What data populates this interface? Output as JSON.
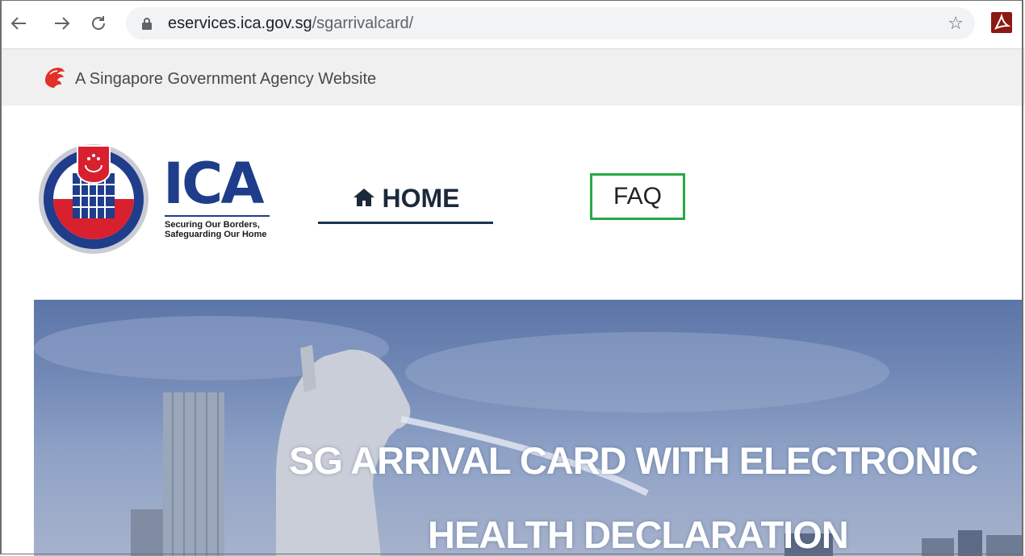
{
  "browser": {
    "url_host": "eservices.ica.gov.sg",
    "url_path": "/sgarrivalcard/",
    "icons": [
      "back-arrow-icon",
      "forward-arrow-icon",
      "reload-icon",
      "lock-icon",
      "bookmark-star-icon",
      "pdf-extension-icon"
    ]
  },
  "masthead": {
    "text": "A Singapore Government Agency Website",
    "icon": "lion-head-icon"
  },
  "logo": {
    "title": "ICA",
    "tagline_line1": "Securing Our Borders,",
    "tagline_line2": "Safeguarding Our Home",
    "brand_color": "#1f3d8a"
  },
  "nav": {
    "home_label": "HOME",
    "faq_label": "FAQ",
    "highlight_color": "#27a844"
  },
  "hero": {
    "line1": "SG ARRIVAL CARD WITH ELECTRONIC",
    "line2": "HEALTH DECLARATION"
  }
}
